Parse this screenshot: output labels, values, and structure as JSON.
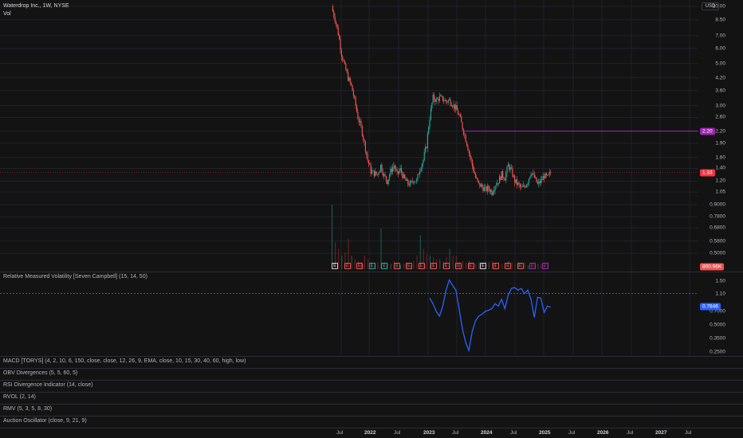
{
  "legend": {
    "symbol_line": "Waterdrop Inc., 1W, NYSE",
    "volume_label": "Vol"
  },
  "currency": "USD",
  "colors": {
    "up": "#26a69a",
    "down": "#ef5350",
    "background": "#131313",
    "grid": "#1e222d",
    "alert_line": "#9c27b0",
    "rmv_line": "#2962ff",
    "price_badge": "#f23645"
  },
  "price_scale": {
    "ticks": [
      "10.00",
      "8.50",
      "7.00",
      "6.00",
      "5.00",
      "4.20",
      "3.60",
      "3.00",
      "2.60",
      "2.20",
      "1.90",
      "1.60",
      "1.40",
      "1.20",
      "1.05",
      "0.9000",
      "0.7800",
      "0.6800",
      "0.5800",
      "0.5000"
    ],
    "alert_value": "2.20",
    "current_price": "1.33",
    "volume_value": "800.96K"
  },
  "earnings_markers": [
    "E",
    "E",
    "E",
    "E",
    "E",
    "E",
    "E",
    "E",
    "E",
    "E",
    "E",
    "E",
    "E",
    "E",
    "E",
    "E",
    "E",
    "E"
  ],
  "rmv_indicator": {
    "title": "Relative Measured Volatility [Seven Campbell] (15, 14, 50)",
    "ticks": [
      "1.50",
      "1.10",
      "0.7000",
      "0.5000",
      "0.3500",
      "0.2500"
    ],
    "current_value": "0.7846"
  },
  "collapsed_indicators": [
    "MACD [TORYS] (4, 2, 10, 6, 150, close, close, 12, 26, 9, EMA, close, 10, 15, 30, 40, 60, high, low)",
    "OBV Divergences (5, 5, 60, 5)",
    "RSI Divergence Indicator (14, close)",
    "RVOL (2, 14)",
    "RMV (5, 3, 5, 8, 30)",
    "Auction Oscillator (close, 9, 21, 9)"
  ],
  "time_axis": {
    "labels": [
      {
        "text": "Jul",
        "year": false
      },
      {
        "text": "2022",
        "year": true
      },
      {
        "text": "Jul",
        "year": false
      },
      {
        "text": "2023",
        "year": true
      },
      {
        "text": "Jul",
        "year": false
      },
      {
        "text": "2024",
        "year": true
      },
      {
        "text": "Jul",
        "year": false
      },
      {
        "text": "2025",
        "year": true
      },
      {
        "text": "Jul",
        "year": false
      },
      {
        "text": "2026",
        "year": true
      },
      {
        "text": "Jul",
        "year": false
      },
      {
        "text": "2027",
        "year": true
      },
      {
        "text": "Jul",
        "year": false
      }
    ]
  },
  "chart_data": {
    "type": "candlestick",
    "log_scale": true,
    "x_unit": "weeks since first bar",
    "close_path": [
      [
        0,
        9.8
      ],
      [
        2,
        8.6
      ],
      [
        4,
        7.2
      ],
      [
        6,
        5.6
      ],
      [
        8,
        4.8
      ],
      [
        10,
        4.2
      ],
      [
        12,
        3.8
      ],
      [
        14,
        3.2
      ],
      [
        16,
        2.6
      ],
      [
        18,
        2.3
      ],
      [
        20,
        1.9
      ],
      [
        22,
        1.55
      ],
      [
        24,
        1.35
      ],
      [
        26,
        1.32
      ],
      [
        28,
        1.3
      ],
      [
        30,
        1.45
      ],
      [
        32,
        1.28
      ],
      [
        34,
        1.2
      ],
      [
        36,
        1.35
      ],
      [
        38,
        1.45
      ],
      [
        40,
        1.3
      ],
      [
        42,
        1.38
      ],
      [
        44,
        1.25
      ],
      [
        46,
        1.18
      ],
      [
        48,
        1.15
      ],
      [
        50,
        1.22
      ],
      [
        52,
        1.2
      ],
      [
        54,
        1.4
      ],
      [
        56,
        1.55
      ],
      [
        58,
        1.85
      ],
      [
        60,
        2.6
      ],
      [
        62,
        3.3
      ],
      [
        64,
        3.2
      ],
      [
        66,
        3.3
      ],
      [
        68,
        3.25
      ],
      [
        70,
        3.15
      ],
      [
        72,
        3.2
      ],
      [
        74,
        3.05
      ],
      [
        76,
        2.9
      ],
      [
        78,
        2.65
      ],
      [
        80,
        2.3
      ],
      [
        82,
        2.0
      ],
      [
        84,
        1.7
      ],
      [
        86,
        1.45
      ],
      [
        88,
        1.25
      ],
      [
        90,
        1.15
      ],
      [
        92,
        1.12
      ],
      [
        94,
        1.08
      ],
      [
        96,
        1.1
      ],
      [
        98,
        1.05
      ],
      [
        100,
        1.15
      ],
      [
        102,
        1.2
      ],
      [
        104,
        1.3
      ],
      [
        106,
        1.25
      ],
      [
        108,
        1.45
      ],
      [
        110,
        1.35
      ],
      [
        112,
        1.2
      ],
      [
        114,
        1.15
      ],
      [
        116,
        1.1
      ],
      [
        118,
        1.12
      ],
      [
        120,
        1.2
      ],
      [
        122,
        1.35
      ],
      [
        124,
        1.25
      ],
      [
        126,
        1.15
      ],
      [
        128,
        1.2
      ],
      [
        130,
        1.28
      ],
      [
        132,
        1.25
      ],
      [
        134,
        1.33
      ]
    ],
    "volume": [
      95,
      40,
      30,
      20,
      25,
      45,
      20,
      15,
      12,
      10,
      20,
      15,
      10,
      10,
      10,
      60,
      10,
      10,
      8,
      12,
      8,
      6,
      8,
      10,
      6,
      12,
      20,
      50,
      30,
      22,
      20,
      18,
      15,
      15,
      12,
      18,
      30,
      20,
      20,
      10,
      12,
      10,
      12,
      10,
      8,
      10,
      8,
      12,
      10,
      12,
      8,
      10,
      8,
      10,
      12,
      10,
      8,
      10,
      8,
      10,
      6,
      8,
      10,
      8,
      8,
      6,
      10
    ],
    "rmv_series": [
      [
        60,
        0.98
      ],
      [
        62,
        0.85
      ],
      [
        64,
        0.7
      ],
      [
        66,
        0.62
      ],
      [
        68,
        0.8
      ],
      [
        70,
        1.2
      ],
      [
        72,
        1.55
      ],
      [
        74,
        1.35
      ],
      [
        76,
        1.2
      ],
      [
        78,
        0.75
      ],
      [
        80,
        0.45
      ],
      [
        82,
        0.32
      ],
      [
        84,
        0.26
      ],
      [
        86,
        0.42
      ],
      [
        88,
        0.55
      ],
      [
        90,
        0.62
      ],
      [
        92,
        0.65
      ],
      [
        94,
        0.7
      ],
      [
        96,
        0.72
      ],
      [
        98,
        0.75
      ],
      [
        100,
        0.85
      ],
      [
        102,
        0.8
      ],
      [
        104,
        0.95
      ],
      [
        106,
        0.75
      ],
      [
        108,
        1.05
      ],
      [
        110,
        1.25
      ],
      [
        112,
        1.28
      ],
      [
        114,
        1.2
      ],
      [
        116,
        1.25
      ],
      [
        118,
        1.1
      ],
      [
        120,
        1.2
      ],
      [
        122,
        0.95
      ],
      [
        124,
        0.6
      ],
      [
        126,
        1.0
      ],
      [
        128,
        0.98
      ],
      [
        130,
        0.68
      ],
      [
        132,
        0.8
      ],
      [
        134,
        0.78
      ]
    ]
  }
}
